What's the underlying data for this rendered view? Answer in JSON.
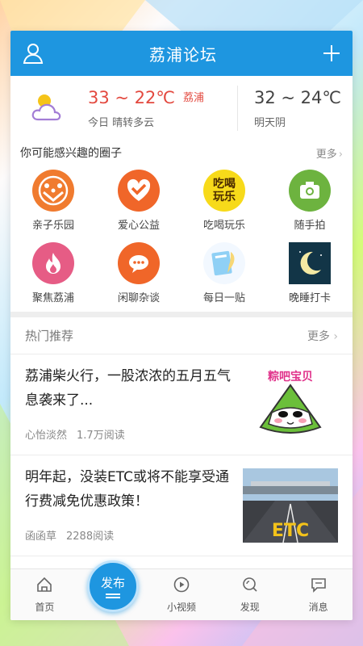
{
  "header": {
    "title": "荔浦论坛",
    "user_icon": "user-icon",
    "add_icon": "plus-icon"
  },
  "weather": {
    "today": {
      "temp": "33 ~ 22℃",
      "city": "荔浦",
      "desc": "今日 晴转多云"
    },
    "tomorrow": {
      "temp": "32 ~ 24℃",
      "desc": "明天阴"
    }
  },
  "circles_section": {
    "title": "你可能感兴趣的圈子",
    "more": "更多",
    "items": [
      {
        "label": "亲子乐园"
      },
      {
        "label": "爱心公益"
      },
      {
        "label": "吃喝玩乐",
        "icon_text_1": "吃喝",
        "icon_text_2": "玩乐"
      },
      {
        "label": "随手拍"
      },
      {
        "label": "聚焦荔浦"
      },
      {
        "label": "闲聊杂谈"
      },
      {
        "label": "每日一贴"
      },
      {
        "label": "晚睡打卡"
      }
    ]
  },
  "hot": {
    "title": "热门推荐",
    "more": "更多",
    "articles": [
      {
        "title": "荔浦柴火行，一股浓浓的五月五气息袭来了...",
        "author": "心怡淡然",
        "reads": "1.7万阅读",
        "thumb_text": "粽吧宝贝"
      },
      {
        "title": "明年起，没装ETC或将不能享受通行费减免优惠政策！",
        "author": "函函草",
        "reads": "2288阅读",
        "thumb_text": "ETC"
      }
    ]
  },
  "tabbar": {
    "items": [
      {
        "label": "首页",
        "icon": "home-icon"
      },
      {
        "label": "",
        "icon": ""
      },
      {
        "label": "小视频",
        "icon": "video-icon"
      },
      {
        "label": "发现",
        "icon": "discover-icon"
      },
      {
        "label": "消息",
        "icon": "message-icon"
      }
    ],
    "publish": "发布"
  },
  "colors": {
    "primary": "#1e96e0",
    "accent_red": "#e3493f"
  }
}
